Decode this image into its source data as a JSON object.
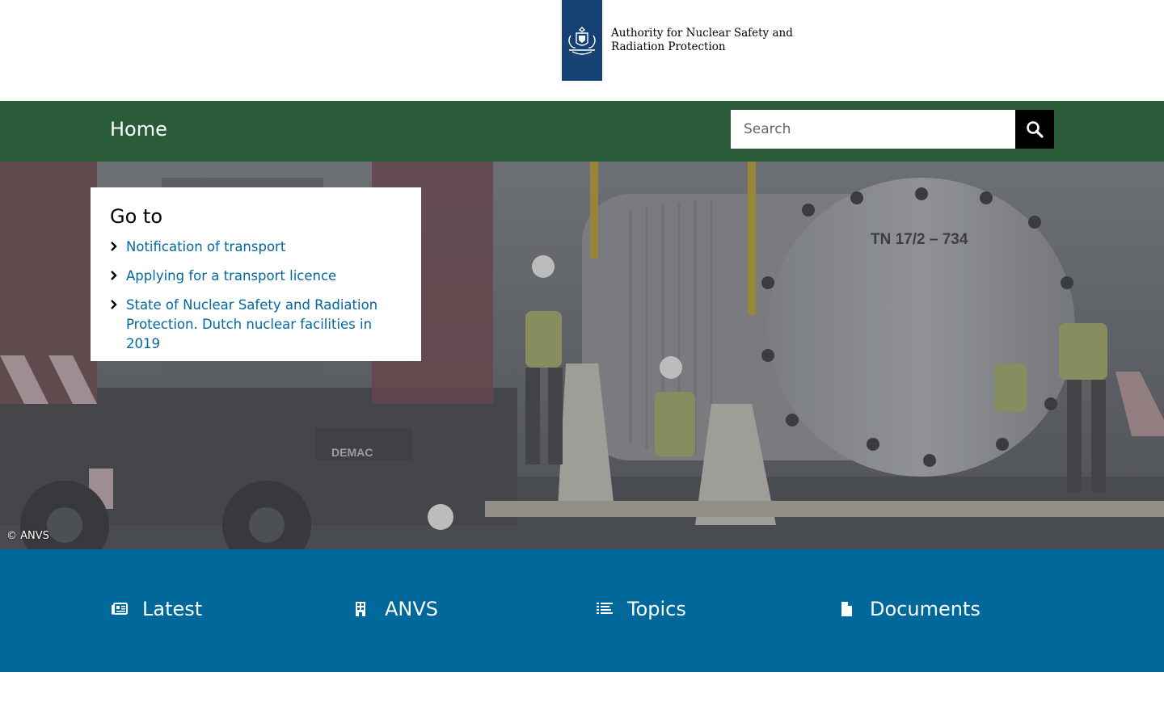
{
  "header": {
    "org_line1": "Authority for Nuclear Safety and",
    "org_line2": "Radiation Protection"
  },
  "nav": {
    "home_label": "Home",
    "search_placeholder": "Search"
  },
  "hero": {
    "credit": "© ANVS",
    "cask_label": "TN 17/2 – 734",
    "crane_label": "DEMAC"
  },
  "goto": {
    "title": "Go to",
    "links": [
      {
        "label": "Notification of transport"
      },
      {
        "label": "Applying for a transport licence"
      },
      {
        "label": "State of Nuclear Safety and Radiation Protection. Dutch nuclear facilities in 2019"
      }
    ]
  },
  "band": {
    "items": [
      {
        "label": "Latest",
        "icon": "newspaper-icon"
      },
      {
        "label": "ANVS",
        "icon": "building-icon"
      },
      {
        "label": "Topics",
        "icon": "list-icon"
      },
      {
        "label": "Documents",
        "icon": "document-icon"
      }
    ]
  },
  "colors": {
    "ribbon": "#154273",
    "nav_green": "#2a5c3a",
    "link_blue": "#01689b",
    "band_blue": "#01689b"
  }
}
